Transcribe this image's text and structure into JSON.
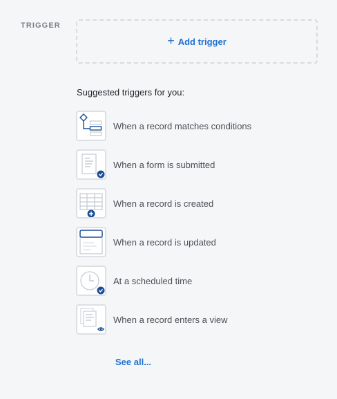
{
  "section_label": "TRIGGER",
  "add_trigger": {
    "icon": "plus-icon",
    "label": "Add trigger"
  },
  "suggested": {
    "title": "Suggested triggers for you:",
    "items": [
      {
        "label": "When a record matches conditions",
        "icon": "conditions-icon"
      },
      {
        "label": "When a form is submitted",
        "icon": "form-submitted-icon"
      },
      {
        "label": "When a record is created",
        "icon": "record-created-icon"
      },
      {
        "label": "When a record is updated",
        "icon": "record-updated-icon"
      },
      {
        "label": "At a scheduled time",
        "icon": "clock-icon"
      },
      {
        "label": "When a record enters a view",
        "icon": "view-icon"
      }
    ]
  },
  "see_all": "See all...",
  "colors": {
    "accent": "#1f6fd1",
    "dark_blue": "#1b4f95",
    "border": "#dcdfe4",
    "background": "#f5f6f8"
  }
}
